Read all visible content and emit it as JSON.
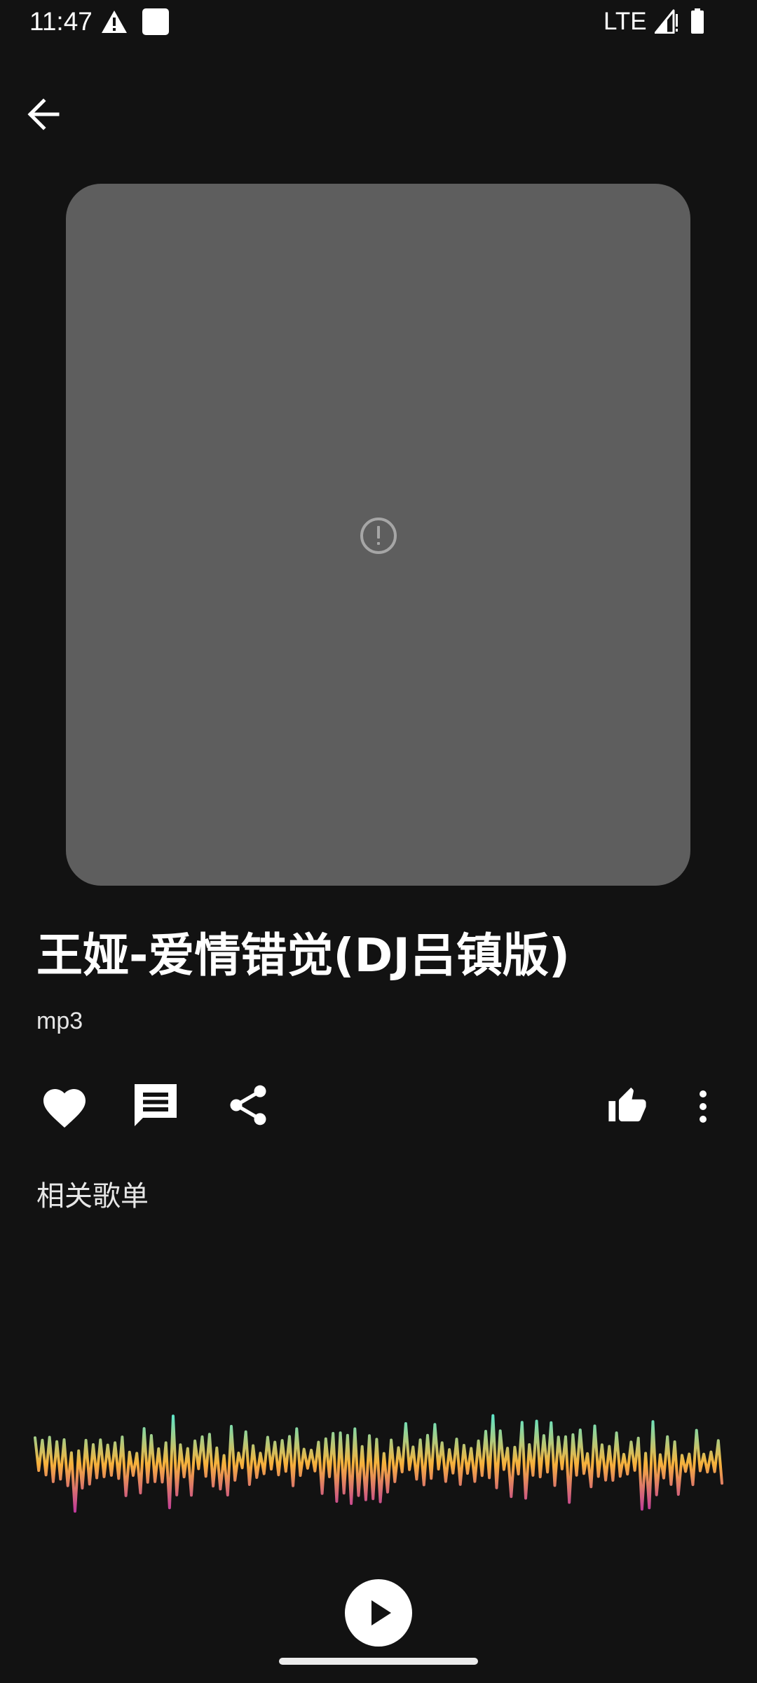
{
  "status_bar": {
    "time": "11:47",
    "network": "LTE",
    "icons": [
      "warning-icon",
      "notification-square-icon",
      "signal-icon",
      "battery-icon"
    ]
  },
  "navigation": {
    "back_icon": "arrow-left-icon"
  },
  "artwork": {
    "state_icon": "error-circle-icon",
    "placeholder_color": "#5e5e5e"
  },
  "song": {
    "title": "王娅-爱情错觉(DJ吕镇版)",
    "format": "mp3"
  },
  "actions": {
    "left": [
      "heart-icon",
      "comment-icon",
      "share-icon"
    ],
    "right": [
      "thumb-up-icon",
      "more-vertical-icon"
    ]
  },
  "related": {
    "heading": "相关歌单"
  },
  "player": {
    "play_icon": "play-icon",
    "waveform_colors": [
      "#5ee5c8",
      "#f7b23b",
      "#c0399b"
    ]
  }
}
